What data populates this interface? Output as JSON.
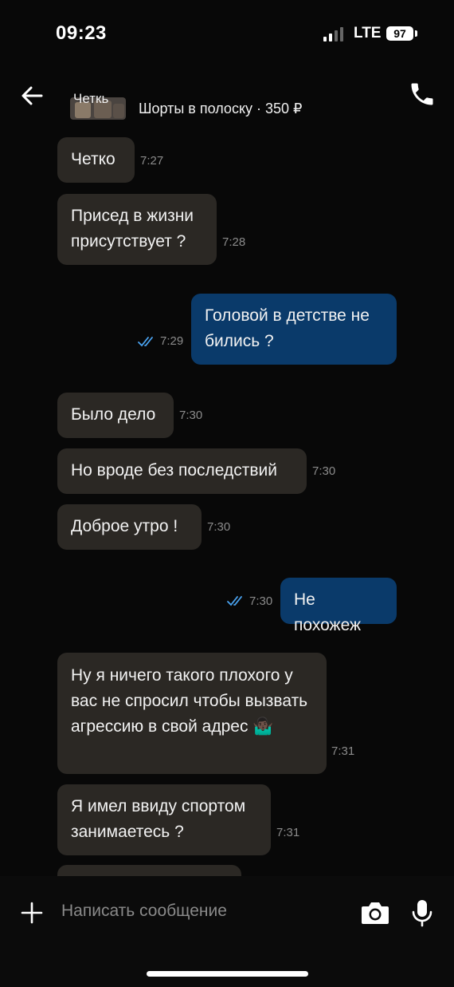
{
  "status_bar": {
    "time": "09:23",
    "network": "LTE",
    "battery": "97"
  },
  "header": {
    "contact_name": "Четкь",
    "product": "Шорты в полоску · 350 ₽",
    "icons": {
      "back": "arrow-left-icon",
      "call": "phone-icon"
    }
  },
  "messages": [
    {
      "dir": "in",
      "text": "Четко",
      "time": "7:27"
    },
    {
      "dir": "in",
      "text": "Присед в жизни присутствует ?",
      "time": "7:28"
    },
    {
      "dir": "out",
      "text": "Головой в детстве не бились ?",
      "time": "7:29",
      "read": true
    },
    {
      "dir": "in",
      "text": "Было дело",
      "time": "7:30"
    },
    {
      "dir": "in",
      "text": "Но вроде без последствий",
      "time": "7:30"
    },
    {
      "dir": "in",
      "text": "Доброе утро !",
      "time": "7:30"
    },
    {
      "dir": "out",
      "text": "Не похожеж",
      "time": "7:30",
      "read": true
    },
    {
      "dir": "in",
      "text": "Ну я ничего такого плохого у вас не спросил чтобы вызвать агрессию в свой адрес 🤷🏿‍♂️",
      "time": "7:31"
    },
    {
      "dir": "in",
      "text": "Я имел ввиду спортом занимаетесь ?",
      "time": "7:31"
    }
  ],
  "composer": {
    "placeholder": "Написать сообщение",
    "icons": {
      "attach": "plus-icon",
      "camera": "camera-icon",
      "voice": "microphone-icon"
    }
  },
  "colors": {
    "incoming": "#2b2824",
    "outgoing": "#0a3a6a",
    "read_ticks": "#4aa3f0"
  }
}
